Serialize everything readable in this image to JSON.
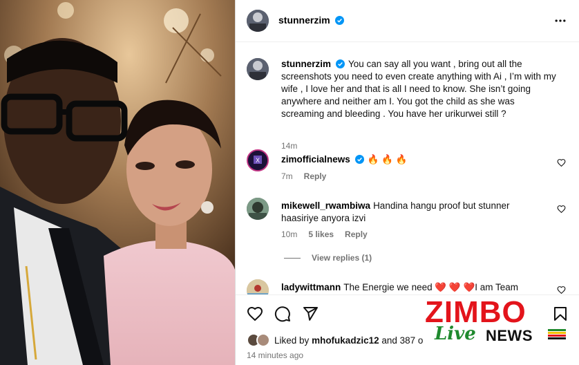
{
  "post": {
    "author": "stunnerzim",
    "caption": "You can say all you want , bring out all the screenshots you need to even create anything with Ai , I’m with my wife , I love her and that is all I need to know. She isn’t going anywhere and neither am I. You got the child as she was screaming and bleeding . You have her urikurwei still ?",
    "caption_time": "14m",
    "liked_by_prefix": "Liked by",
    "liked_by_user": "mhofukadzic12",
    "liked_by_suffix": "and 387 o",
    "timestamp": "14 minutes ago"
  },
  "comments": [
    {
      "user": "zimofficialnews",
      "text": "🔥 🔥 🔥",
      "time": "7m",
      "likes": "",
      "reply": "Reply",
      "verified": true
    },
    {
      "user": "mikewell_rwambiwa",
      "text": "Handina hangu proof but stunner haasiriye anyora izvi",
      "time": "10m",
      "likes": "5 likes",
      "reply": "Reply",
      "verified": false
    },
    {
      "user": "ladywittmann",
      "text": "The Energie we need ❤️ ❤️ ❤️I am Team",
      "time": "",
      "likes": "",
      "reply": "",
      "verified": false
    }
  ],
  "view_replies": "View replies (1)",
  "watermark": {
    "brand": "ZIMBO",
    "live": "Live",
    "news": "NEWS"
  },
  "icons": {
    "more": "more-horizontal-icon",
    "like": "heart-icon",
    "comment": "comment-icon",
    "share": "send-icon",
    "save": "bookmark-icon",
    "verified": "verified-badge-icon"
  },
  "colors": {
    "verified": "#0095f6",
    "meta": "#737373",
    "brand_red": "#e3141b",
    "brand_green": "#1f8a2e"
  }
}
